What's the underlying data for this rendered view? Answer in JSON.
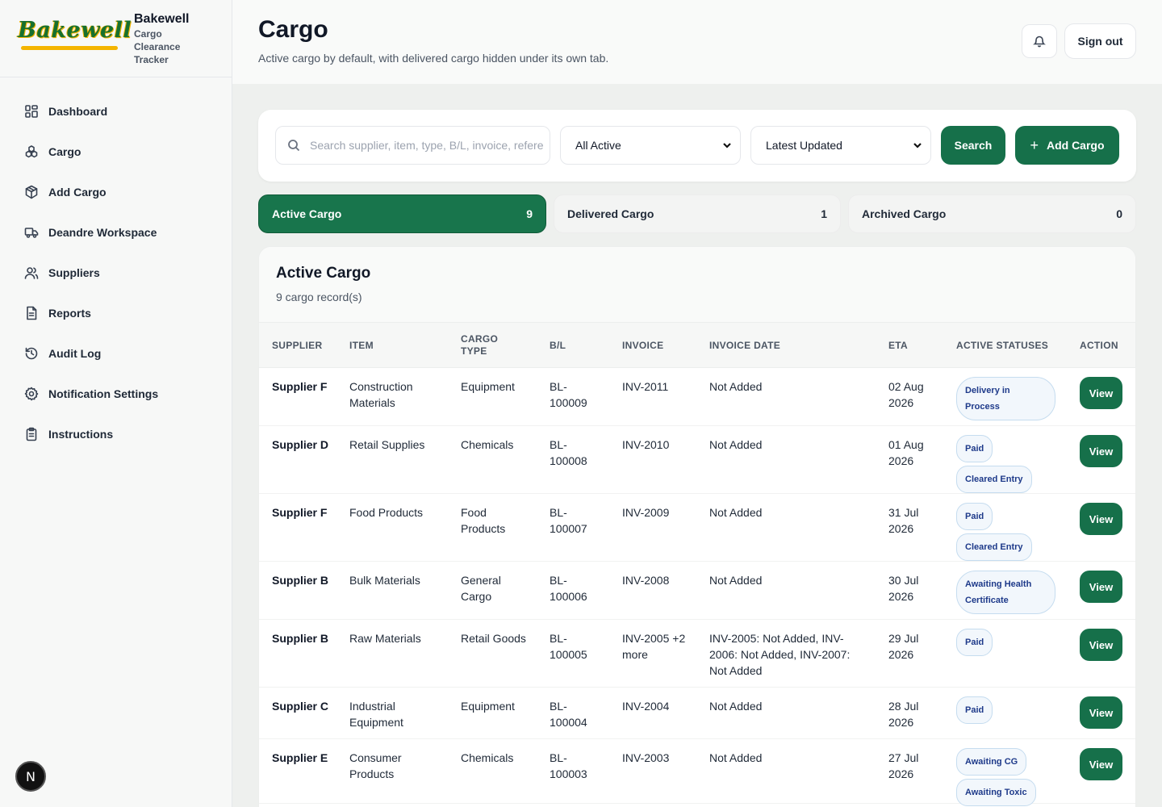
{
  "brand": {
    "name": "Bakewell",
    "logo_text": "Bakewell",
    "subtitle": "Cargo Clearance Tracker"
  },
  "nav": [
    {
      "label": "Dashboard",
      "icon": "dashboard-icon"
    },
    {
      "label": "Cargo",
      "icon": "boxes-icon"
    },
    {
      "label": "Add Cargo",
      "icon": "package-plus-icon"
    },
    {
      "label": "Deandre Workspace",
      "icon": "truck-icon"
    },
    {
      "label": "Suppliers",
      "icon": "users-icon"
    },
    {
      "label": "Reports",
      "icon": "file-icon"
    },
    {
      "label": "Audit Log",
      "icon": "history-icon"
    },
    {
      "label": "Notification Settings",
      "icon": "gear-icon"
    },
    {
      "label": "Instructions",
      "icon": "clipboard-icon"
    }
  ],
  "dev_badge": "N",
  "header": {
    "title": "Cargo",
    "subtitle": "Active cargo by default, with delivered cargo hidden under its own tab.",
    "signout": "Sign out"
  },
  "filters": {
    "search_placeholder": "Search supplier, item, type, B/L, invoice, reference",
    "status_value": "All Active",
    "sort_value": "Latest Updated",
    "search_button": "Search",
    "add_button": "Add Cargo"
  },
  "tabs": [
    {
      "label": "Active Cargo",
      "count": "9"
    },
    {
      "label": "Delivered Cargo",
      "count": "1"
    },
    {
      "label": "Archived Cargo",
      "count": "0"
    }
  ],
  "table": {
    "title": "Active Cargo",
    "subtitle": "9 cargo record(s)",
    "columns": [
      "SUPPLIER",
      "ITEM",
      "CARGO TYPE",
      "B/L",
      "INVOICE",
      "INVOICE DATE",
      "ETA",
      "ACTIVE STATUSES",
      "ACTION"
    ],
    "view_label": "View",
    "rows": [
      {
        "supplier": "Supplier F",
        "item": "Construction Materials",
        "type": "Equipment",
        "bl": "BL-100009",
        "invoice": "INV-2011",
        "invoice_date": "Not Added",
        "eta": "02 Aug 2026",
        "statuses": [
          "Delivery in Process"
        ]
      },
      {
        "supplier": "Supplier D",
        "item": "Retail Supplies",
        "type": "Chemicals",
        "bl": "BL-100008",
        "invoice": "INV-2010",
        "invoice_date": "Not Added",
        "eta": "01 Aug 2026",
        "statuses": [
          "Paid",
          "Cleared Entry"
        ]
      },
      {
        "supplier": "Supplier F",
        "item": "Food Products",
        "type": "Food Products",
        "bl": "BL-100007",
        "invoice": "INV-2009",
        "invoice_date": "Not Added",
        "eta": "31 Jul 2026",
        "statuses": [
          "Paid",
          "Cleared Entry"
        ]
      },
      {
        "supplier": "Supplier B",
        "item": "Bulk Materials",
        "type": "General Cargo",
        "bl": "BL-100006",
        "invoice": "INV-2008",
        "invoice_date": "Not Added",
        "eta": "30 Jul 2026",
        "statuses": [
          "Awaiting Health Certificate"
        ]
      },
      {
        "supplier": "Supplier B",
        "item": "Raw Materials",
        "type": "Retail Goods",
        "bl": "BL-100005",
        "invoice": "INV-2005 +2 more",
        "invoice_date": "INV-2005: Not Added, INV-2006: Not Added, INV-2007: Not Added",
        "eta": "29 Jul 2026",
        "statuses": [
          "Paid"
        ]
      },
      {
        "supplier": "Supplier C",
        "item": "Industrial Equipment",
        "type": "Equipment",
        "bl": "BL-100004",
        "invoice": "INV-2004",
        "invoice_date": "Not Added",
        "eta": "28 Jul 2026",
        "statuses": [
          "Paid"
        ]
      },
      {
        "supplier": "Supplier E",
        "item": "Consumer Products",
        "type": "Chemicals",
        "bl": "BL-100003",
        "invoice": "INV-2003",
        "invoice_date": "Not Added",
        "eta": "27 Jul 2026",
        "statuses": [
          "Awaiting CG",
          "Awaiting Toxic"
        ]
      }
    ]
  },
  "colors": {
    "primary": "#16704a",
    "badge_text": "#1e3a8a",
    "badge_bg": "#f2f7fc"
  }
}
